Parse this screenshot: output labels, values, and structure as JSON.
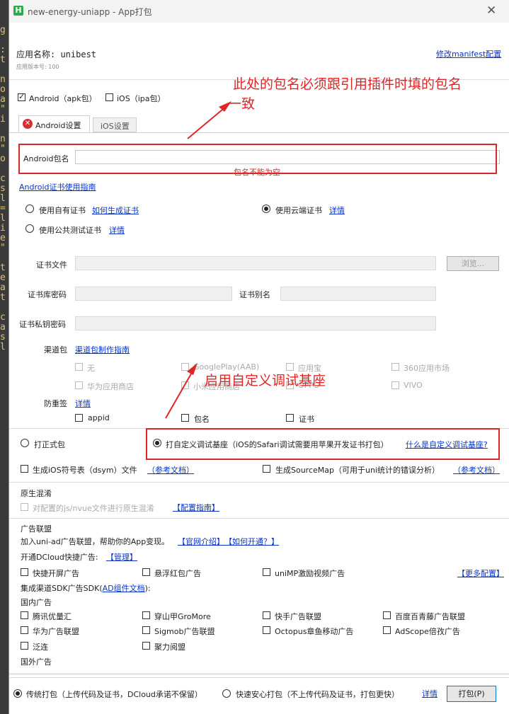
{
  "window": {
    "title": "new-energy-uniapp - App打包",
    "logo_letter": "H",
    "close_glyph": "✕"
  },
  "editor_edge": [
    "g",
    "",
    ":",
    "t",
    "",
    "n",
    "o",
    "a",
    "\"",
    "i",
    "",
    "n",
    "\"",
    "o",
    "",
    "c",
    "s",
    "l",
    "=",
    "l",
    "i",
    "e",
    "\"",
    "",
    "t",
    "e",
    "a",
    "t",
    "",
    "c",
    "a",
    "s",
    "l"
  ],
  "app": {
    "name_label": "应用名称: unibest",
    "version_label": "应用版本号: 100",
    "manifest_link": "修改manifest配置"
  },
  "platforms": {
    "android": "Android（apk包）",
    "ios": "iOS（ipa包）"
  },
  "tabs": {
    "android": "Android设置",
    "ios": "iOS设置"
  },
  "android": {
    "package_label": "Android包名",
    "package_value": "",
    "package_error": "包名不能为空",
    "cert_guide_link": "Android证书使用指南"
  },
  "cert": {
    "own": "使用自有证书",
    "own_link": "如何生成证书",
    "cloud": "使用云端证书",
    "cloud_link": "详情",
    "public_test": "使用公共测试证书",
    "public_link": "详情",
    "file_label": "证书文件",
    "browse": "浏览...",
    "store_pwd": "证书库密码",
    "alias": "证书别名",
    "key_pwd": "证书私钥密码"
  },
  "channel": {
    "label": "渠道包",
    "guide_link": "渠道包制作指南",
    "items": [
      "无",
      "GooglePlay(AAB)",
      "应用宝",
      "360应用市场",
      "华为应用商店",
      "小米应用商店",
      "OPPO",
      "VIVO"
    ]
  },
  "antitamper": {
    "label": "防重签",
    "link": "详情",
    "items": [
      "appid",
      "包名",
      "证书"
    ]
  },
  "build": {
    "formal": "打正式包",
    "custom_base": "打自定义调试基座（iOS的Safari调试需要用苹果开发证书打包）",
    "custom_link": "什么是自定义调试基座?"
  },
  "symbols": {
    "ios_dsym": "生成iOS符号表（dsym）文件",
    "ios_dsym_link": "（参考文档）",
    "sourcemap": "生成SourceMap（可用于uni统计的错误分析）",
    "sourcemap_link": "（参考文档）"
  },
  "obfuscation": {
    "title": "原生混淆",
    "option": "对配置的js/nvue文件进行原生混淆",
    "link": "【配置指南】"
  },
  "ads": {
    "title": "广告联盟",
    "intro": "加入uni-ad广告联盟，帮助你的App变现。",
    "intro_link1": "【官网介绍】",
    "intro_link2": "【如何开通？】",
    "dcloud": "开通DCloud快捷广告:",
    "dcloud_link": "【管理】",
    "quick_items": [
      "快捷开屏广告",
      "悬浮红包广告",
      "uniMP激励视频广告"
    ],
    "more_link": "【更多配置】",
    "sdk_title": "集成渠道SDK广告SDK(",
    "sdk_link": "AD组件文档",
    "sdk_end": "):",
    "domestic": "国内广告",
    "domestic_items": [
      "腾讯优量汇",
      "穿山甲GroMore",
      "快手广告联盟",
      "百度百青藤广告联盟",
      "华为广告联盟",
      "Sigmob广告联盟",
      "Octopus章鱼移动广告",
      "AdScope倍孜广告",
      "泛连",
      "聚力阅盟"
    ],
    "foreign": "国外广告"
  },
  "footer": {
    "traditional": "传统打包（上传代码及证书，DCloud承诺不保留）",
    "safe": "快速安心打包（不上传代码及证书，打包更快）",
    "detail_link": "详情",
    "pack_button": "打包(P)"
  },
  "annotations": {
    "package_note_line1": "此处的包名必须跟引用插件时填的包名",
    "package_note_line2": "一致",
    "base_note": "启用自定义调试基座"
  },
  "colors": {
    "annotation_red": "#e02525",
    "link_blue": "#0b33c4",
    "logo_green": "#2eaa4e"
  }
}
